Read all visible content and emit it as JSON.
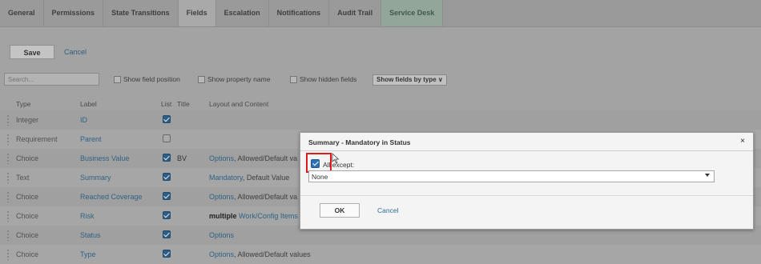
{
  "tabs": [
    {
      "label": "General"
    },
    {
      "label": "Permissions"
    },
    {
      "label": "State Transitions"
    },
    {
      "label": "Fields"
    },
    {
      "label": "Escalation"
    },
    {
      "label": "Notifications"
    },
    {
      "label": "Audit Trail"
    },
    {
      "label": "Service Desk"
    }
  ],
  "toolbar": {
    "save_label": "Save",
    "cancel_label": "Cancel"
  },
  "filters": {
    "search_placeholder": "Search...",
    "show_field_position": "Show field position",
    "show_property_name": "Show property name",
    "show_hidden_fields": "Show hidden fields",
    "show_fields_by": "Show fields by type ∨"
  },
  "table": {
    "headers": {
      "type": "Type",
      "label": "Label",
      "list": "List",
      "title": "Title",
      "layout": "Layout and Content"
    },
    "rows": [
      {
        "type": "Integer",
        "label": "ID",
        "list": true,
        "title": "",
        "layout": []
      },
      {
        "type": "Requirement",
        "label": "Parent",
        "list": false,
        "title": "",
        "layout": []
      },
      {
        "type": "Choice",
        "label": "Business Value",
        "list": true,
        "title": "BV",
        "layout": [
          {
            "text": "Options",
            "style": "lnk"
          },
          {
            "text": ", Allowed/Default va",
            "style": "dim"
          }
        ]
      },
      {
        "type": "Text",
        "label": "Summary",
        "list": true,
        "title": "",
        "layout": [
          {
            "text": "Mandatory",
            "style": "lnk"
          },
          {
            "text": ", Default Value",
            "style": "dim"
          }
        ]
      },
      {
        "type": "Choice",
        "label": "Reached Coverage",
        "list": true,
        "title": "",
        "layout": [
          {
            "text": "Options",
            "style": "lnk"
          },
          {
            "text": ", Allowed/Default va",
            "style": "dim"
          }
        ]
      },
      {
        "type": "Choice",
        "label": "Risk",
        "list": true,
        "title": "",
        "layout": [
          {
            "text": "multiple ",
            "style": "strong"
          },
          {
            "text": "Work/Config Items",
            "style": "lnk"
          },
          {
            "text": " [",
            "style": "dim"
          }
        ]
      },
      {
        "type": "Choice",
        "label": "Status",
        "list": true,
        "title": "",
        "layout": [
          {
            "text": "Options",
            "style": "lnk"
          }
        ]
      },
      {
        "type": "Choice",
        "label": "Type",
        "list": true,
        "title": "",
        "layout": [
          {
            "text": "Options",
            "style": "lnk"
          },
          {
            "text": ", Allowed/Default values",
            "style": "dim"
          }
        ]
      }
    ]
  },
  "dialog": {
    "title": "Summary - Mandatory in Status",
    "close_glyph": "×",
    "all_except_label": "All except:",
    "select_value": "None",
    "ok_label": "OK",
    "cancel_label": "Cancel"
  },
  "colors": {
    "highlight": "#e11b1b",
    "link": "#2f6385",
    "checkbox": "#2f6fb4"
  }
}
